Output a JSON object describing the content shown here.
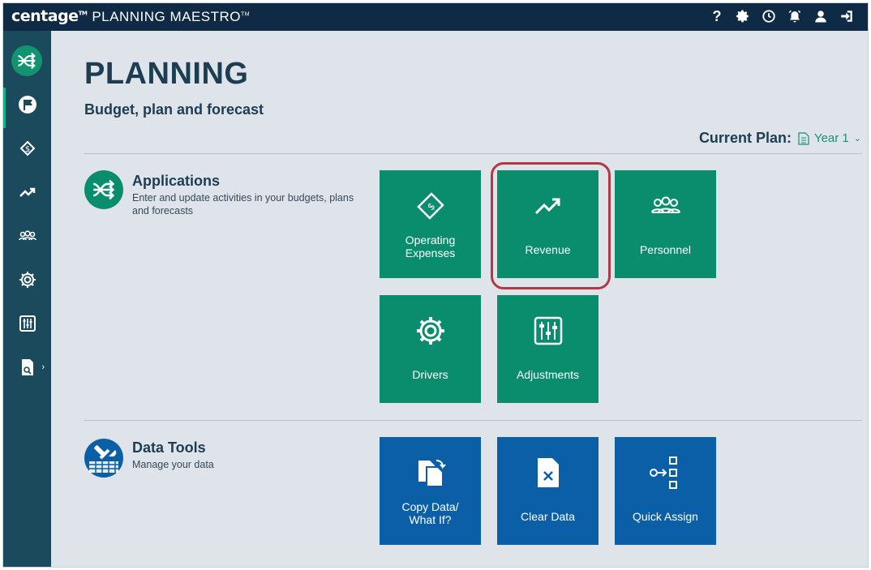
{
  "header": {
    "brand": "centage",
    "brand_tm": "TM",
    "product": "PLANNING MAESTRO",
    "product_tm": "TM",
    "icons": [
      "help-icon",
      "gear-icon",
      "history-icon",
      "alarm-icon",
      "user-icon",
      "logout-icon"
    ],
    "help_glyph": "?"
  },
  "sidebar": {
    "items": [
      {
        "name": "planning",
        "icon": "flag-icon",
        "active": true
      },
      {
        "name": "operating-expenses",
        "icon": "money-icon"
      },
      {
        "name": "revenue",
        "icon": "trend-icon"
      },
      {
        "name": "personnel",
        "icon": "people-icon"
      },
      {
        "name": "drivers",
        "icon": "gear-icon"
      },
      {
        "name": "adjustments",
        "icon": "sliders-icon"
      },
      {
        "name": "reports",
        "icon": "report-icon"
      }
    ],
    "reports_chevron": "›"
  },
  "page": {
    "title": "PLANNING",
    "subtitle": "Budget, plan and forecast",
    "current_plan_label": "Current Plan:",
    "current_plan_value": "Year 1",
    "caret": "⌄"
  },
  "applications": {
    "title": "Applications",
    "description": "Enter and update activities in your budgets, plans and forecasts",
    "tiles": [
      {
        "label": "Operating\nExpenses",
        "icon": "money-icon"
      },
      {
        "label": "Revenue",
        "icon": "trend-icon",
        "highlighted": true
      },
      {
        "label": "Personnel",
        "icon": "people-icon"
      },
      {
        "label": "Drivers",
        "icon": "gear-icon"
      },
      {
        "label": "Adjustments",
        "icon": "sliders-icon"
      }
    ]
  },
  "data_tools": {
    "title": "Data Tools",
    "description": "Manage your data",
    "tiles": [
      {
        "label": "Copy Data/\nWhat If?",
        "icon": "copy-icon"
      },
      {
        "label": "Clear Data",
        "icon": "clear-file-icon"
      },
      {
        "label": "Quick Assign",
        "icon": "assign-icon"
      }
    ]
  },
  "colors": {
    "topbar": "#0e2a44",
    "rail": "#1b4a5c",
    "green_tile": "#0a8d6c",
    "blue_tile": "#0b5fa7",
    "highlight": "#b03a43",
    "accent": "#1a8f73"
  }
}
